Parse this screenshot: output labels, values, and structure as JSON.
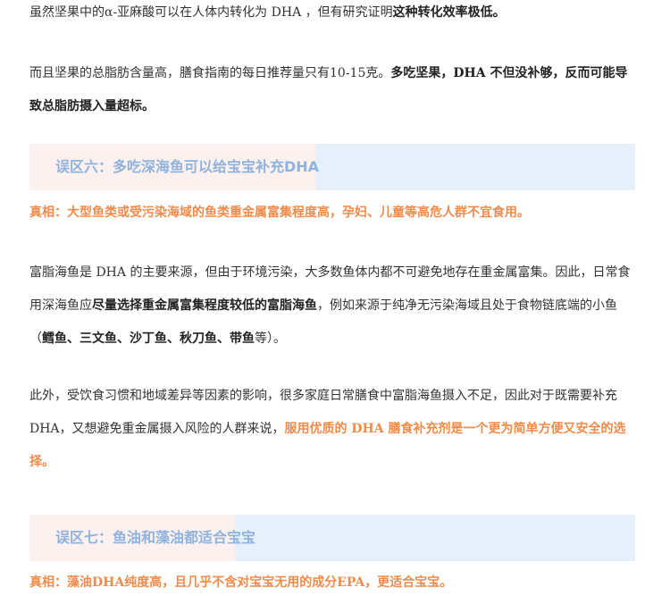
{
  "p1": {
    "t1": "虽然坚果中的α-亚麻酸可以在人体内转化为 DHA ，但有研究证明",
    "b1": "这种转化效率极低。"
  },
  "p2": {
    "t1": "而且坚果的总脂肪含量高，膳食指南的每日推荐量只有10-15克。",
    "b1": "多吃坚果，DHA 不但没补够，反而可能导致总脂肪摄入量超标。"
  },
  "section6": {
    "title": "误区六：多吃深海鱼可以给宝宝补充DHA",
    "truth": "真相：大型鱼类或受污染海域的鱼类重金属富集程度高，孕妇、儿童等高危人群不宜食用。"
  },
  "p3": {
    "t1": "富脂海鱼是 DHA 的主要来源，但由于环境污染，大多数鱼体内都不可避免地存在重金属富集。因此，日常食用深海鱼应",
    "b1": "尽量选择重金属富集程度较低的富脂海鱼",
    "t2": "，例如来源于纯净无污染海域且处于食物链底端的小鱼（",
    "b2": "鳕鱼、三文鱼、沙丁鱼、秋刀鱼、带鱼",
    "t3": "等）。"
  },
  "p4": {
    "t1": "此外，受饮食习惯和地域差异等因素的影响，很多家庭日常膳食中富脂海鱼摄入不足，因此对于既需要补充 DHA，又想避免重金属摄入风险的人群来说，",
    "o1": "服用优质的 DHA 膳食补充剂是一个更为简单方便又安全的选择。"
  },
  "section7": {
    "title": "误区七：鱼油和藻油都适合宝宝",
    "truth": "真相：藻油DHA纯度高，且几乎不含对宝宝无用的成分EPA，更适合宝宝。"
  }
}
